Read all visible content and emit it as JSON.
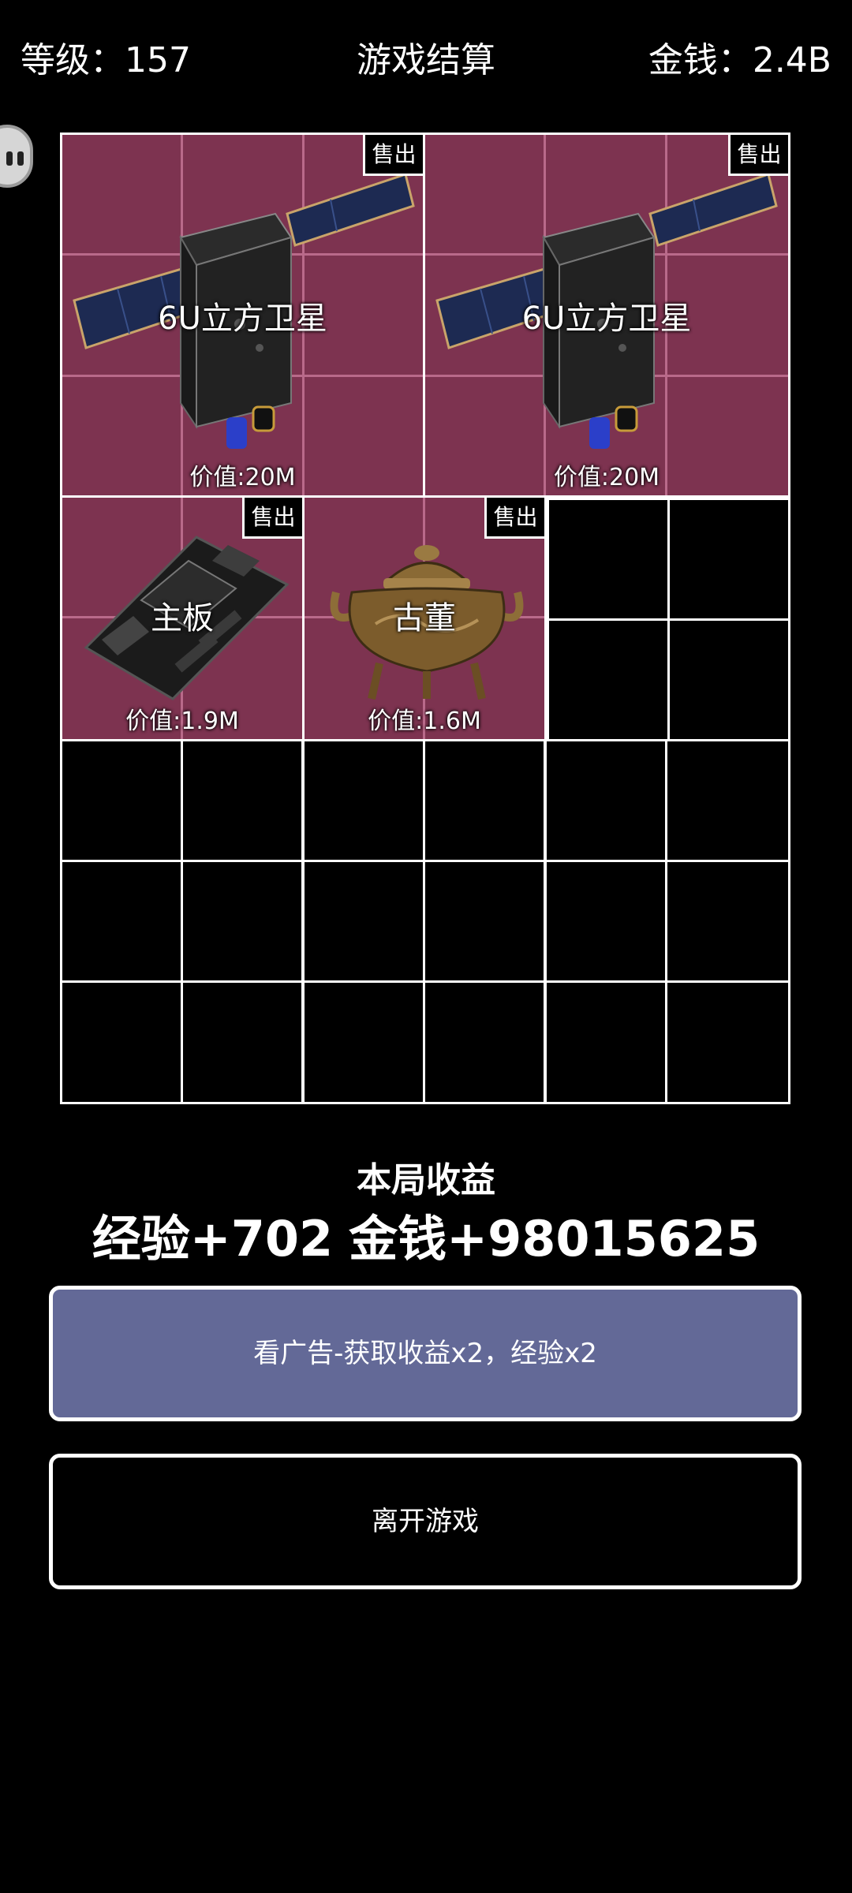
{
  "header": {
    "level_text": "等级：157",
    "title": "游戏结算",
    "money_text": "金钱：2.4B"
  },
  "inventory": {
    "items": [
      {
        "name": "6U立方卫星",
        "value": "价值:20M",
        "sell_label": "售出",
        "icon": "satellite-icon"
      },
      {
        "name": "6U立方卫星",
        "value": "价值:20M",
        "sell_label": "售出",
        "icon": "satellite-icon"
      },
      {
        "name": "主板",
        "value": "价值:1.9M",
        "sell_label": "售出",
        "icon": "motherboard-icon"
      },
      {
        "name": "古董",
        "value": "价值:1.6M",
        "sell_label": "售出",
        "icon": "antique-censer-icon"
      }
    ]
  },
  "earnings": {
    "title": "本局收益",
    "exp": "经验+702",
    "money": "金钱+98015625"
  },
  "buttons": {
    "ad_label": "看广告-获取收益x2，经验x2",
    "leave_label": "离开游戏"
  },
  "colors": {
    "background": "#000000",
    "item_bg": "#7d3350",
    "ad_button": "#636997"
  }
}
